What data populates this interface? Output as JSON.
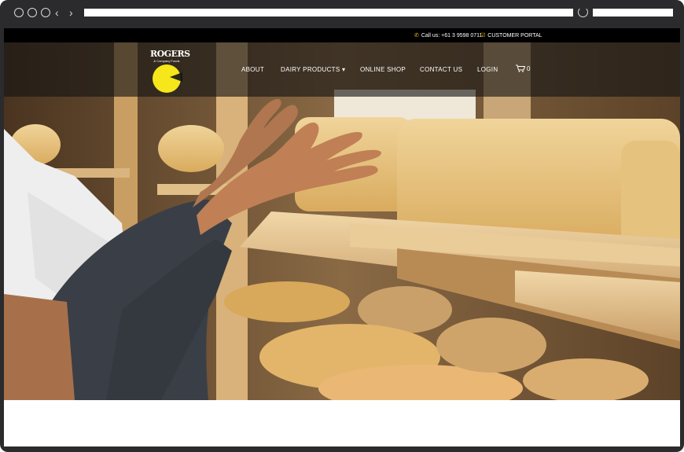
{
  "browser": {
    "controls": [
      "circle-icon",
      "circle-icon",
      "circle-icon"
    ],
    "back_icon": "chevron-left-icon",
    "forward_icon": "chevron-right-icon",
    "refresh_icon": "refresh-icon"
  },
  "topbar": {
    "phone_label": "Call us: +61 3 9598 0711",
    "portal_label": "CUSTOMER PORTAL",
    "icon_color": "#f2c21b"
  },
  "logo": {
    "name": "ROGERS",
    "sub": "& Company Foods",
    "circle_color": "#f5e71a"
  },
  "nav": {
    "about": "ABOUT",
    "dairy": "DAIRY PRODUCTS",
    "dairy_chevron": "▾",
    "shop": "ONLINE SHOP",
    "contact": "CONTACT US",
    "login": "LOGIN",
    "cart_count": "0"
  }
}
